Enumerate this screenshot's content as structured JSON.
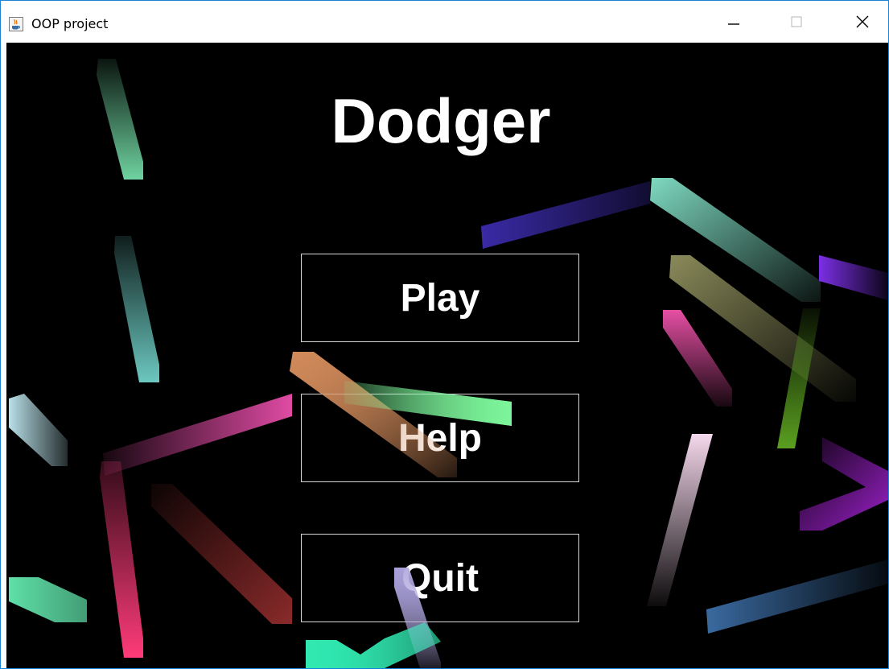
{
  "window": {
    "title": "OOP project",
    "app_icon": "java-cup-icon",
    "controls": {
      "minimize_icon": "minimize-icon",
      "maximize_icon": "maximize-icon",
      "close_icon": "close-icon"
    }
  },
  "game": {
    "title": "Dodger",
    "menu": {
      "play_label": "Play",
      "help_label": "Help",
      "quit_label": "Quit"
    }
  },
  "colors": {
    "background": "#000000",
    "text": "#ffffff",
    "button_border": "#d8d8d8",
    "window_border": "#1883d7"
  }
}
